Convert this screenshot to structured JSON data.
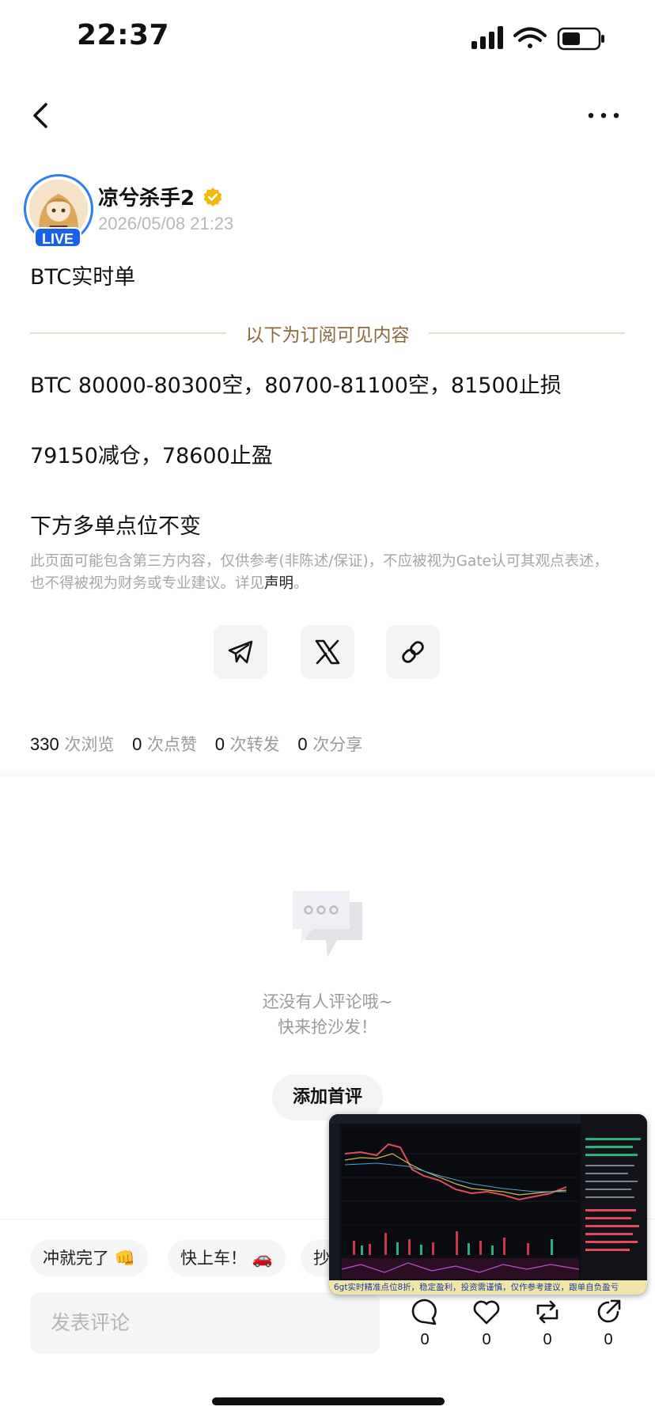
{
  "status_bar": {
    "time": "22:37"
  },
  "post": {
    "author": {
      "name": "凉兮杀手2",
      "live_badge": "LIVE"
    },
    "timestamp": "2026/05/08 21:23",
    "title": "BTC实时单",
    "subscription_divider": "以下为订阅可见内容",
    "body": [
      "BTC 80000-80300空，80700-81100空，81500止损",
      "79150减仓，78600止盈",
      "下方多单点位不变"
    ],
    "disclaimer": {
      "text": "此页面可能包含第三方内容，仅供参考(非陈述/保证)，不应被视为Gate认可其观点表述，也不得被视为财务或专业建议。详见",
      "link": "声明",
      "end": "。"
    }
  },
  "share_buttons": [
    {
      "name": "telegram-icon"
    },
    {
      "name": "x-icon"
    },
    {
      "name": "link-icon"
    }
  ],
  "stats": {
    "views": "330",
    "views_label": "次浏览",
    "likes": "0",
    "likes_label": "次点赞",
    "reposts": "0",
    "reposts_label": "次转发",
    "shares": "0",
    "shares_label": "次分享"
  },
  "comments_empty": {
    "line1": "还没有人评论哦~",
    "line2": "快来抢沙发！",
    "button": "添加首评"
  },
  "quick_replies": [
    "冲就完了 👊",
    "快上车！ 🚗",
    "抄"
  ],
  "comment_input": {
    "placeholder": "发表评论"
  },
  "actions": [
    {
      "name": "comment-icon",
      "count": "0"
    },
    {
      "name": "heart-icon",
      "count": "0"
    },
    {
      "name": "repost-icon",
      "count": "0"
    },
    {
      "name": "share-icon",
      "count": "0"
    }
  ],
  "pip_video": {
    "caption": "6gt实时精准点位8折，稳定盈利，投资需谨慎，仅作参考建议，跟单自负盈亏"
  },
  "colors": {
    "live_badge": "#1561e8",
    "divider_text": "#8a6a3b",
    "verified": "#f0b90b"
  }
}
